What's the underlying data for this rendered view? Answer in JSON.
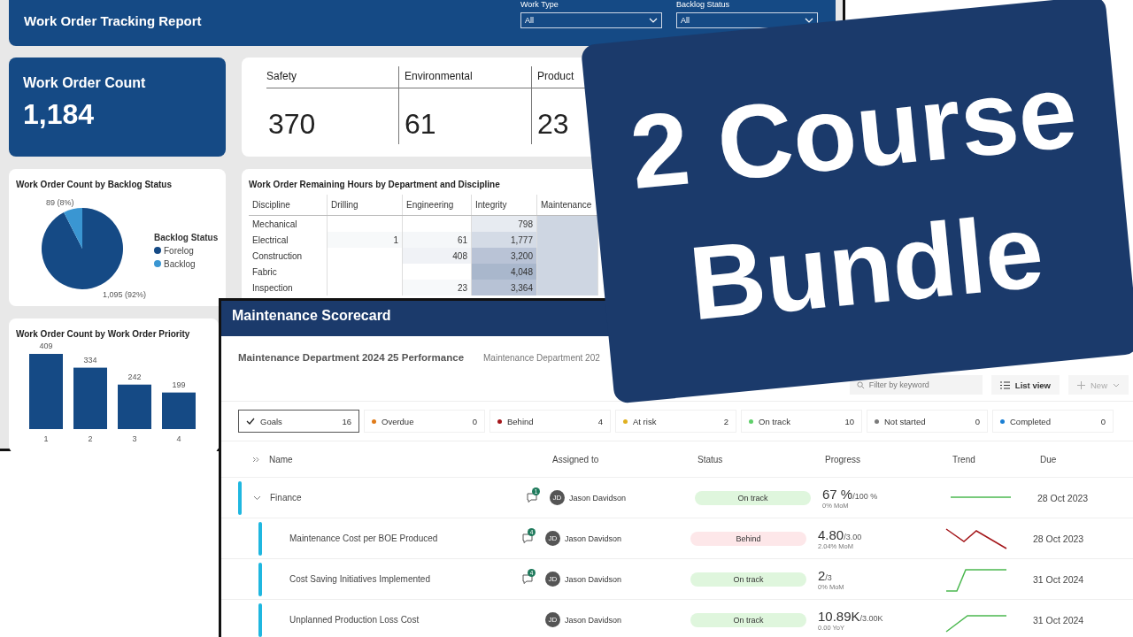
{
  "report": {
    "title": "Work Order Tracking Report",
    "filters": [
      {
        "label": "Work Type",
        "value": "All"
      },
      {
        "label": "Backlog Status",
        "value": "All"
      }
    ],
    "kpi": {
      "label": "Work Order Count",
      "value": "1,184"
    },
    "categories": [
      {
        "label": "Safety",
        "value": "370"
      },
      {
        "label": "Environmental",
        "value": "61"
      },
      {
        "label": "Product",
        "value": "23"
      }
    ],
    "pie_card": {
      "title": "Work Order Count by Backlog Status",
      "legend_title": "Backlog Status",
      "legend": [
        {
          "color": "#154a85"
        },
        {
          "color": "#3a96d2"
        }
      ],
      "chart_data": {
        "type": "pie",
        "categories": [
          "Forelog",
          "Backlog"
        ],
        "values": [
          1095,
          89
        ],
        "value_labels": [
          "1,095 (92%)",
          "89 (8%)"
        ]
      }
    },
    "matrix": {
      "title": "Work Order Remaining Hours by Department and Discipline",
      "columns": [
        "Discipline",
        "Drilling",
        "Engineering",
        "Integrity",
        "Maintenance"
      ],
      "rows": [
        {
          "cells": [
            "Mechanical",
            "",
            "",
            "798"
          ]
        },
        {
          "cells": [
            "Electrical",
            "1",
            "61",
            "1,777"
          ]
        },
        {
          "cells": [
            "Construction",
            "",
            "408",
            "3,200"
          ]
        },
        {
          "cells": [
            "Fabric",
            "",
            "",
            "4,048"
          ]
        },
        {
          "cells": [
            "Inspection",
            "",
            "23",
            "3,364"
          ]
        }
      ]
    },
    "bar_card": {
      "title": "Work Order Count by Work Order Priority",
      "chart_data": {
        "type": "bar",
        "categories": [
          "1",
          "2",
          "3",
          "4"
        ],
        "values": [
          409,
          334,
          242,
          199
        ],
        "data_labels": true
      }
    }
  },
  "scorecard": {
    "title": "Maintenance Scorecard",
    "subtitle": "Maintenance Department 2024 25 Performance",
    "subtitle_2": "Maintenance Department 202",
    "search": {
      "placeholder": "Filter by keyword"
    },
    "view_button": "List view",
    "new_button": {
      "label": "New",
      "disabled": true
    },
    "status_filters": [
      {
        "kind": "check",
        "label": "Goals",
        "count": "16",
        "selected": true
      },
      {
        "kind": "dot",
        "label": "Overdue",
        "count": "0",
        "selected": false,
        "color": "#e07b1a"
      },
      {
        "kind": "dot",
        "label": "Behind",
        "count": "4",
        "selected": false,
        "color": "#a4161a"
      },
      {
        "kind": "dot",
        "label": "At risk",
        "count": "2",
        "selected": false,
        "color": "#e0b020"
      },
      {
        "kind": "dot",
        "label": "On track",
        "count": "10",
        "selected": false,
        "color": "#5fcf6a"
      },
      {
        "kind": "dot",
        "label": "Not started",
        "count": "0",
        "selected": false,
        "color": "#7a7a7a"
      },
      {
        "kind": "dot",
        "label": "Completed",
        "count": "0",
        "selected": false,
        "color": "#1a7fd4"
      }
    ],
    "columns": [
      "Name",
      "Assigned to",
      "Status",
      "Progress",
      "Trend",
      "Due"
    ],
    "goals": [
      {
        "name": "Finance",
        "expanded": true,
        "comments": "1",
        "owner_initials": "JD",
        "owner": "Jason Davidson",
        "status": {
          "kind": "on_track",
          "label": "On track"
        },
        "value": "67 %",
        "target": "/100 %",
        "change": "0% MoM",
        "due": "28 Oct 2023",
        "children": [
          {
            "name": "Maintenance Cost per BOE Produced",
            "comments": "4",
            "owner_initials": "JD",
            "owner": "Jason Davidson",
            "status": {
              "kind": "behind",
              "label": "Behind"
            },
            "value": "4.80",
            "target": "/3.00",
            "change": "2.04% MoM",
            "due": "28 Oct 2023"
          },
          {
            "name": "Cost Saving Initiatives Implemented",
            "comments": "4",
            "owner_initials": "JD",
            "owner": "Jason Davidson",
            "status": {
              "kind": "on_track",
              "label": "On track"
            },
            "value": "2",
            "target": "/3",
            "change": "0% MoM",
            "due": "31 Oct 2024"
          },
          {
            "name": "Unplanned Production Loss Cost",
            "owner_initials": "JD",
            "owner": "Jason Davidson",
            "status": {
              "kind": "on_track",
              "label": "On track"
            },
            "value": "10.89K",
            "target": "/3.00K",
            "change": "0.00 YoY",
            "due": "31 Oct 2024"
          }
        ]
      }
    ]
  },
  "banner": {
    "text": "2 Course Bundle"
  }
}
